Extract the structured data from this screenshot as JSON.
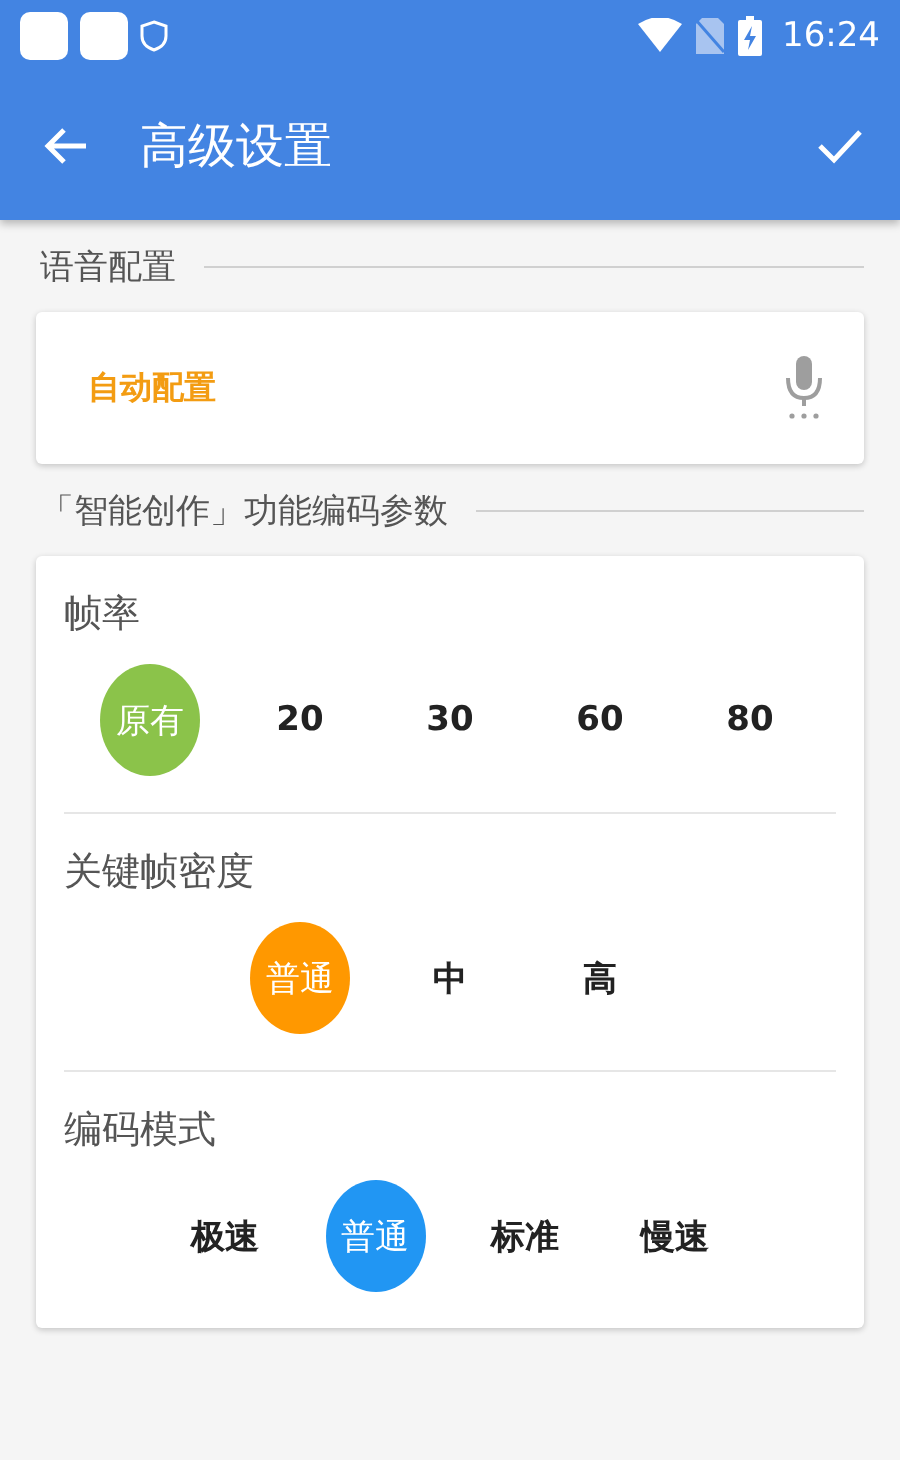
{
  "status_bar": {
    "time": "16:24"
  },
  "app_bar": {
    "title": "高级设置"
  },
  "sections": [
    {
      "title": "语音配置",
      "kind": "voice",
      "value": "自动配置"
    },
    {
      "title": "「智能创作」功能编码参数",
      "kind": "groups",
      "groups": [
        {
          "label": "帧率",
          "color": "#8bc34a",
          "options": [
            {
              "label": "原有",
              "selected": true
            },
            {
              "label": "20",
              "selected": false
            },
            {
              "label": "30",
              "selected": false
            },
            {
              "label": "60",
              "selected": false
            },
            {
              "label": "80",
              "selected": false
            }
          ]
        },
        {
          "label": "关键帧密度",
          "color": "#ff9800",
          "options": [
            {
              "label": "普通",
              "selected": true
            },
            {
              "label": "中",
              "selected": false
            },
            {
              "label": "高",
              "selected": false
            }
          ]
        },
        {
          "label": "编码模式",
          "color": "#2196f3",
          "options": [
            {
              "label": "极速",
              "selected": false
            },
            {
              "label": "普通",
              "selected": true
            },
            {
              "label": "标准",
              "selected": false
            },
            {
              "label": "慢速",
              "selected": false
            }
          ]
        }
      ]
    }
  ]
}
